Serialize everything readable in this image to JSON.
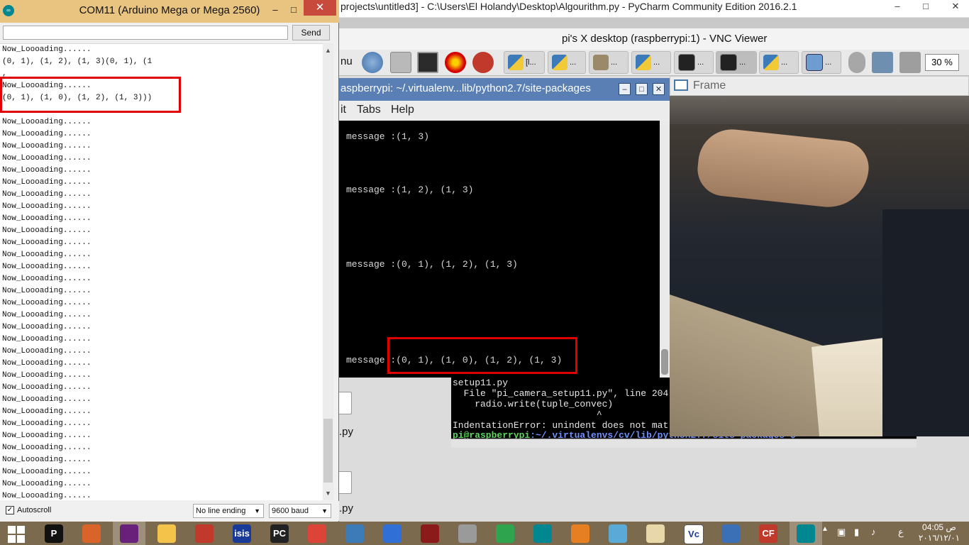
{
  "pycharm": {
    "title": "projects\\untitled3] - C:\\Users\\El Holandy\\Desktop\\Algourithm.py - PyCharm Community Edition 2016.2.1"
  },
  "vnc": {
    "title": "pi's X desktop (raspberrypi:1) - VNC Viewer",
    "menu_partial": "nu",
    "zoom": "30 %",
    "panel_buttons": [
      "[l...",
      "...",
      "...",
      "...",
      "...",
      "...",
      "...",
      "..."
    ]
  },
  "terminal": {
    "title": "aspberrypi: ~/.virtualenv...lib/python2.7/site-packages",
    "menu": [
      "it",
      "Tabs",
      "Help"
    ],
    "messages": [
      "message :(1, 3)",
      "message :(1, 2), (1, 3)",
      "message :(0, 1), (1, 2), (1, 3)",
      "message :(0, 1), (1, 0), (1, 2), (1, 3)"
    ]
  },
  "terminal2": {
    "lines": [
      "setup11.py",
      "  File \"pi_camera_setup11.py\", line 204",
      "    radio.write(tuple_convec)",
      "                          ^",
      "IndentationError: unindent does not mat"
    ],
    "prompt_user": "pi@raspberrypi",
    "prompt_path": ":~/.virtualenvs/cv/lib/python2.7/site-packages $"
  },
  "desktop_files": [
    ".py",
    ".py"
  ],
  "frame": {
    "title": "Frame"
  },
  "serial": {
    "title": "COM11 (Arduino Mega or Mega 2560)",
    "input_value": "",
    "send_label": "Send",
    "lines": [
      "Now_Loooading......",
      "(0, 1), (1, 2), (1, 3)(0, 1), (1",
      ",",
      "Now_Loooading......",
      "(0, 1), (1, 0), (1, 2), (1, 3)))",
      "",
      "Now_Loooading......",
      "Now_Loooading......",
      "Now_Loooading......",
      "Now_Loooading......",
      "Now_Loooading......",
      "Now_Loooading......",
      "Now_Loooading......",
      "Now_Loooading......",
      "Now_Loooading......",
      "Now_Loooading......",
      "Now_Loooading......",
      "Now_Loooading......",
      "Now_Loooading......",
      "Now_Loooading......",
      "Now_Loooading......",
      "Now_Loooading......",
      "Now_Loooading......",
      "Now_Loooading......",
      "Now_Loooading......",
      "Now_Loooading......",
      "Now_Loooading......",
      "Now_Loooading......",
      "Now_Loooading......",
      "Now_Loooading......",
      "Now_Loooading......",
      "Now_Loooading......",
      "Now_Loooading......",
      "Now_Loooading......",
      "Now_Loooading......",
      "Now_Loooading......",
      "Now_Loooading......",
      "Now_Loooading......"
    ],
    "autoscroll_label": "Autoscroll",
    "autoscroll_checked": true,
    "line_ending": "No line ending",
    "baud": "9600 baud"
  },
  "taskbar": {
    "items": [
      "start",
      "pycharm-p",
      "matlab",
      "visual-studio",
      "file-explorer",
      "app-red",
      "isis-proteus",
      "pycharm",
      "chrome",
      "python",
      "app-swirl",
      "app-chinese",
      "webcam",
      "wifi-app",
      "arduino",
      "media-player",
      "app-blue",
      "paint",
      "vnc",
      "network-app",
      "cf-app",
      "arduino-active"
    ],
    "labels": {
      "pycharm_p": "P",
      "isis": "isis",
      "pycharm": "PC",
      "vnc": "Vc",
      "cf": "CF"
    },
    "clock_time": "04:05",
    "clock_ampm": "ص",
    "date": "٢٠١٦/١٢/٠١",
    "lang": "ع"
  },
  "colors": {
    "serial_title_bg": "#e9c480",
    "terminal_title_bg": "#5a7fb5",
    "annotation": "#e00000",
    "taskbar_bg": "#7c6a4e"
  }
}
